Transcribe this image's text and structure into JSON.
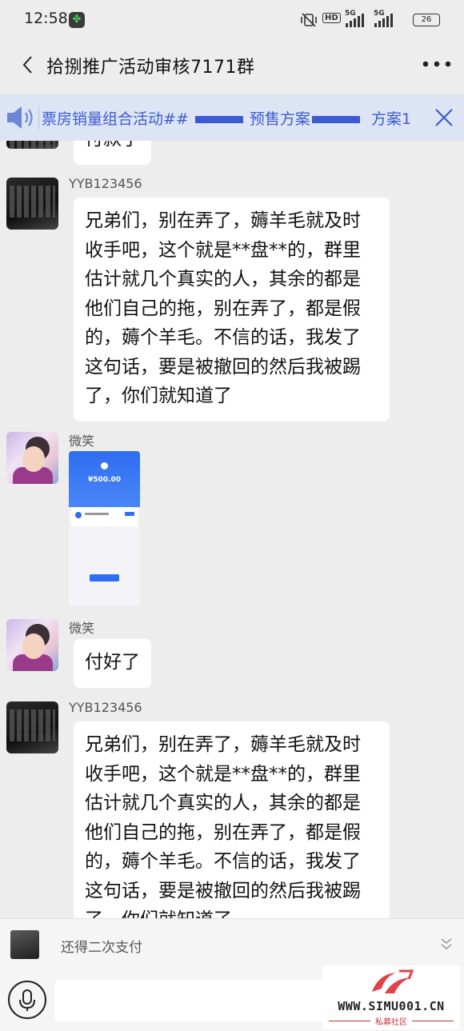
{
  "status_bar": {
    "time": "12:58",
    "hd": "HD",
    "net1": "5G",
    "net2": "5G",
    "battery": "26"
  },
  "header": {
    "title": "拾捌推广活动审核7171群"
  },
  "notice": {
    "text_1": "票房销量组合活动##",
    "text_2": "预售方案",
    "text_3": "方案1"
  },
  "chat": {
    "partial_text": "付款了",
    "messages": [
      {
        "sender": "YYB123456",
        "text": [
          "兄弟们，别在弄了，薅羊毛就及时",
          "收手吧，这个就是**盘**的，群里",
          "估计就几个真实的人，其余的都是",
          "他们自己的拖，别在弄了，都是假",
          "的，薅个羊毛。不信的话，我发了",
          "这句话，要是被撤回的然后我被踢",
          "了，你们就知道了"
        ]
      },
      {
        "sender": "微笑",
        "image_amount": "¥500.00"
      },
      {
        "sender": "微笑",
        "text": "付好了"
      },
      {
        "sender": "YYB123456",
        "text": [
          "兄弟们，别在弄了，薅羊毛就及时",
          "收手吧，这个就是**盘**的，群里",
          "估计就几个真实的人，其余的都是",
          "他们自己的拖，别在弄了，都是假",
          "的，薅个羊毛。不信的话，我发了",
          "这句话，要是被撤回的然后我被踢",
          "了，你们就知道了"
        ]
      }
    ]
  },
  "input_bar": {
    "quote_text": "还得二次支付"
  },
  "watermark": {
    "site": "WWW.SIMU001.CN",
    "label": "私募社区"
  },
  "colors": {
    "notice_text": "#3c5bd0",
    "notice_bg": "#dde5f5",
    "background": "#ededed"
  }
}
